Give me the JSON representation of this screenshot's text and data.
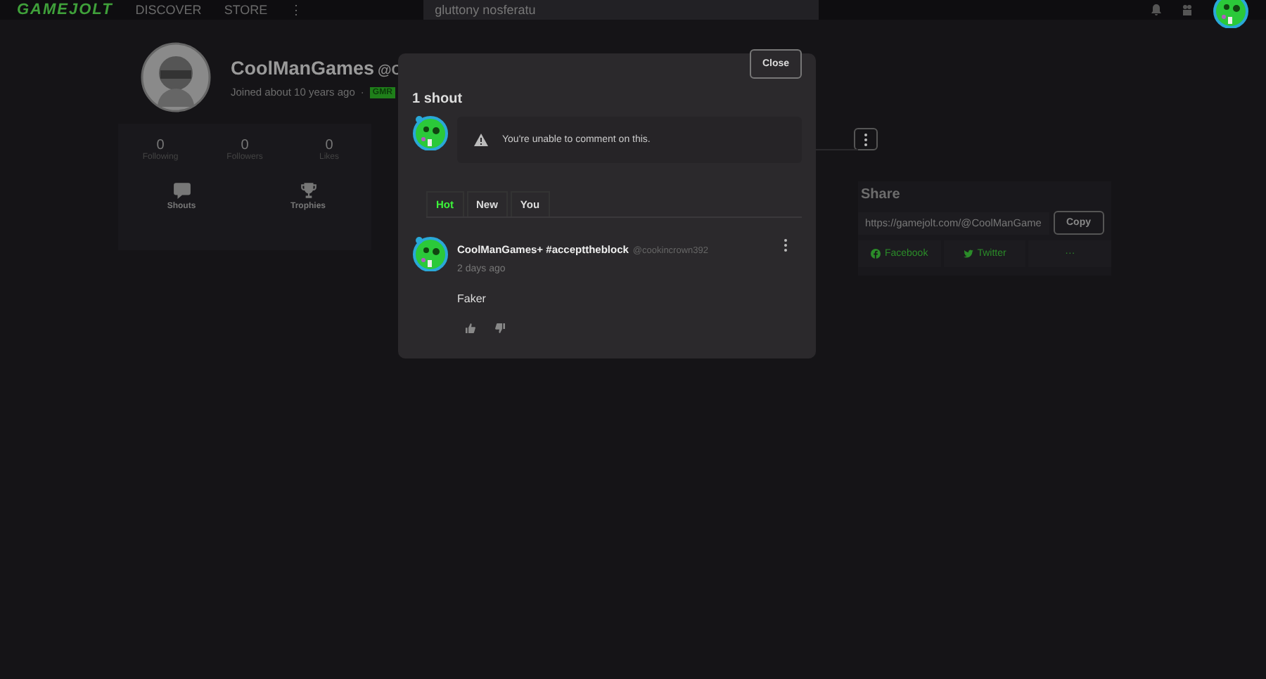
{
  "top_bar": {
    "logo": "GAMEJOLT",
    "nav": [
      "DISCOVER",
      "STORE"
    ],
    "more": "⋮",
    "search": {
      "value": "gluttony nosferatu"
    }
  },
  "profile": {
    "name": "CoolManGames",
    "handle": "@C",
    "joined": "Joined about 10 years ago",
    "separator": "·",
    "badge": "GMR",
    "stats": [
      {
        "value": "0",
        "label": "Following"
      },
      {
        "value": "0",
        "label": "Followers"
      },
      {
        "value": "0",
        "label": "Likes"
      }
    ],
    "links": [
      {
        "kind": "shouts",
        "label": "Shouts"
      },
      {
        "kind": "trophies",
        "label": "Trophies"
      }
    ]
  },
  "share": {
    "title": "Share",
    "url": "https://gamejolt.com/@CoolManGame",
    "copy": "Copy",
    "networks": [
      {
        "kind": "facebook",
        "label": "Facebook"
      },
      {
        "kind": "twitter",
        "label": "Twitter"
      },
      {
        "kind": "more",
        "label": "···"
      }
    ]
  },
  "modal": {
    "close": "Close",
    "title": "1 shout",
    "notice": "You're unable to comment on this.",
    "tabs": [
      {
        "label": "Hot",
        "selected": true
      },
      {
        "label": "New",
        "selected": false
      },
      {
        "label": "You",
        "selected": false
      }
    ],
    "comments": [
      {
        "author": "CoolManGames+ #accepttheblock",
        "handle": "@cookincrown392",
        "time": "2 days ago",
        "text": "Faker"
      }
    ]
  }
}
